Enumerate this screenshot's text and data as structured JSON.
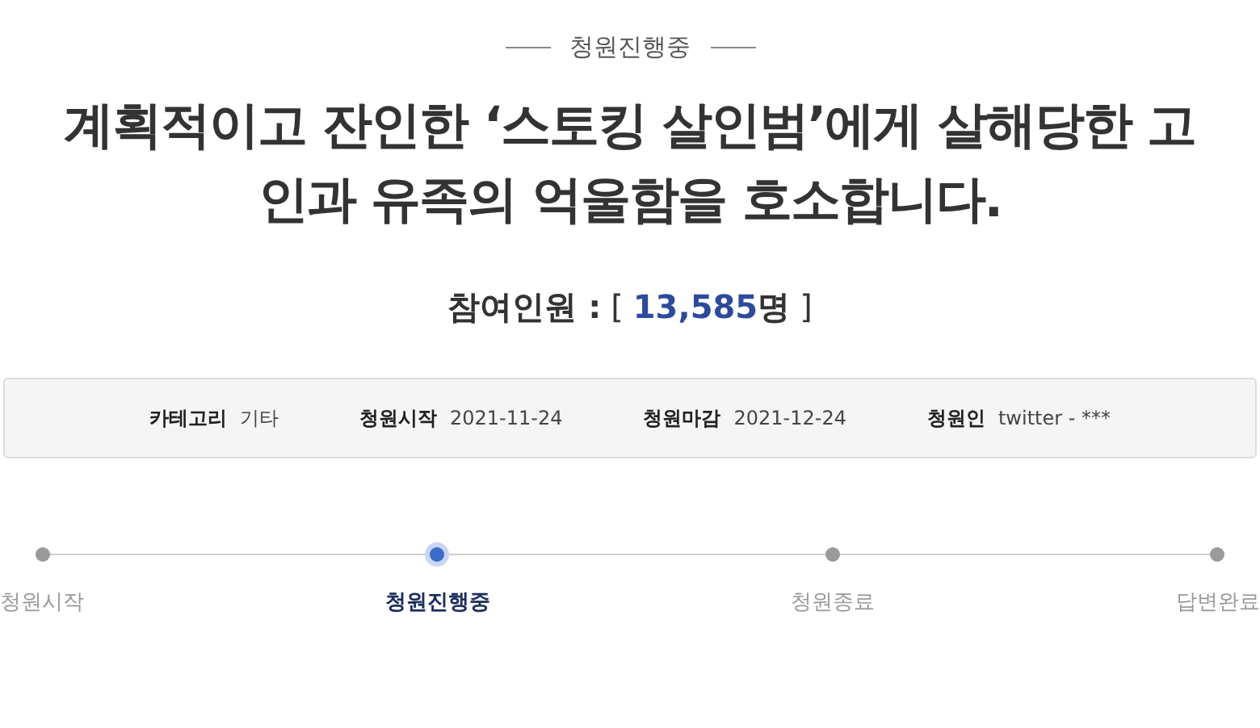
{
  "status_label": "청원진행중",
  "title": "계획적이고 잔인한 ‘스토킹 살인범’에게 살해당한 고인과 유족의 억울함을 호소합니다.",
  "participants": {
    "label": "참여인원 :",
    "open": "[",
    "count": "13,585",
    "unit": "명",
    "close": "]"
  },
  "info": [
    {
      "label": "카테고리",
      "value": "기타"
    },
    {
      "label": "청원시작",
      "value": "2021-11-24"
    },
    {
      "label": "청원마감",
      "value": "2021-12-24"
    },
    {
      "label": "청원인",
      "value": "twitter - ***"
    }
  ],
  "progress_steps": [
    {
      "label": "청원시작",
      "selected": false
    },
    {
      "label": "청원진행중",
      "selected": true
    },
    {
      "label": "청원종료",
      "selected": false
    },
    {
      "label": "답변완료",
      "selected": false
    }
  ]
}
